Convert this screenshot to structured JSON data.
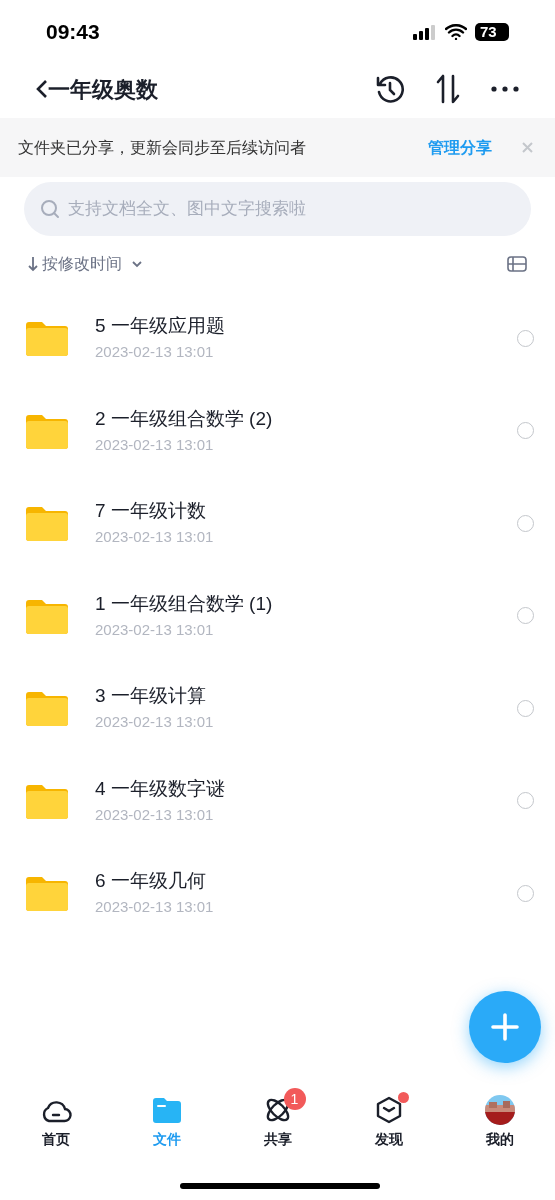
{
  "status_bar": {
    "time": "09:43",
    "battery": "73"
  },
  "header": {
    "title": "一年级奥数"
  },
  "banner": {
    "text": "文件夹已分享，更新会同步至后续访问者",
    "action": "管理分享"
  },
  "search": {
    "placeholder": "支持文档全文、图中文字搜索啦"
  },
  "sort": {
    "label": "按修改时间"
  },
  "files": [
    {
      "name": "5 一年级应用题",
      "date": "2023-02-13 13:01",
      "selected": false
    },
    {
      "name": "2 一年级组合数学 (2)",
      "date": "2023-02-13 13:01",
      "selected": false
    },
    {
      "name": "7 一年级计数",
      "date": "2023-02-13 13:01",
      "selected": false
    },
    {
      "name": "1 一年级组合数学 (1)",
      "date": "2023-02-13 13:01",
      "selected": false
    },
    {
      "name": "3 一年级计算",
      "date": "2023-02-13 13:01",
      "selected": false
    },
    {
      "name": "4 一年级数字谜",
      "date": "2023-02-13 13:01",
      "selected": false
    },
    {
      "name": "6 一年级几何",
      "date": "2023-02-13 13:01",
      "selected": false
    }
  ],
  "tabs": [
    {
      "kind": "home",
      "label": "首页",
      "selected": false
    },
    {
      "kind": "files",
      "label": "文件",
      "selected": true
    },
    {
      "kind": "share",
      "label": "共享",
      "selected": false,
      "badge": "1"
    },
    {
      "kind": "discover",
      "label": "发现",
      "selected": false,
      "dot": true
    },
    {
      "kind": "me",
      "label": "我的",
      "selected": false
    }
  ]
}
